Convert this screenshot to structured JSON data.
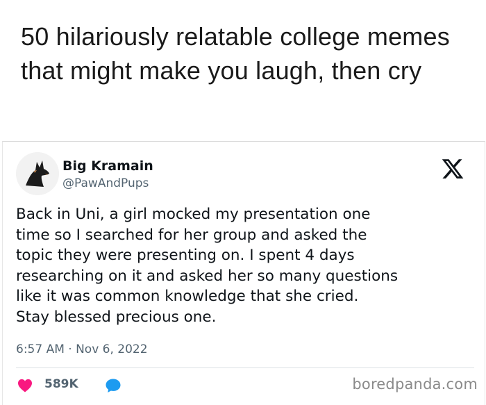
{
  "headline": "50 hilariously relatable college memes that might make you laugh, then cry",
  "tweet": {
    "author_name": "Big Kramain",
    "author_handle": "@PawAndPups",
    "text": "Back in Uni, a girl mocked my presentation one\ntime so I searched for her group and asked the\ntopic they were presenting on. I spent 4 days\nresearching on it and asked her so many questions\nlike it was common knowledge that she cried.\nStay blessed precious one.",
    "timestamp": "6:57 AM · Nov 6, 2022",
    "likes": "589K"
  },
  "icons": {
    "platform": "x-logo-icon",
    "like": "heart-icon",
    "reply": "speech-bubble-icon"
  },
  "colors": {
    "heart": "#f91880",
    "reply": "#1d9bf0",
    "secondary_text": "#536471"
  },
  "watermark": "boredpanda.com"
}
